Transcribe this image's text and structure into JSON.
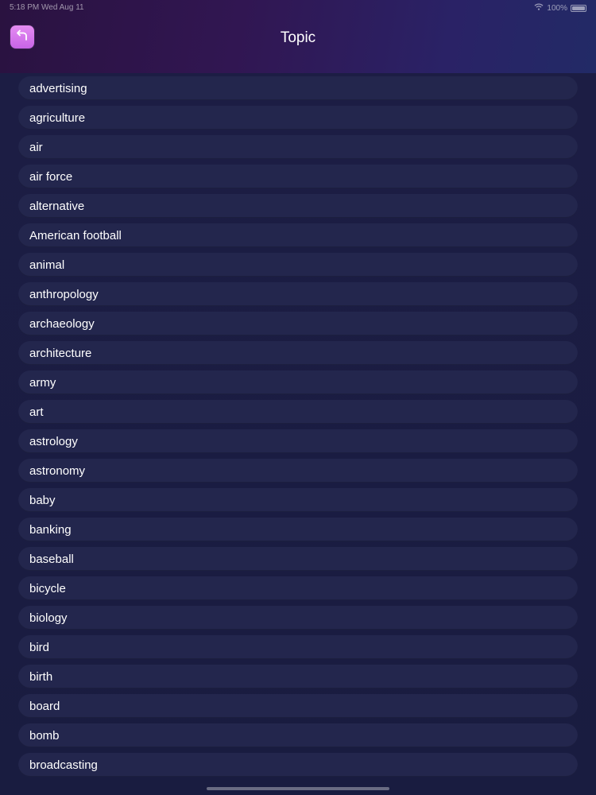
{
  "status_bar": {
    "time_date": "5:18 PM   Wed Aug 11",
    "battery": "100%"
  },
  "header": {
    "title": "Topic",
    "back_icon": "back-arrow-icon"
  },
  "topics": [
    "advertising",
    "agriculture",
    "air",
    "air force",
    "alternative",
    "American football",
    "animal",
    "anthropology",
    "archaeology",
    "architecture",
    "army",
    "art",
    "astrology",
    "astronomy",
    "baby",
    "banking",
    "baseball",
    "bicycle",
    "biology",
    "bird",
    "birth",
    "board",
    "bomb",
    "broadcasting"
  ],
  "colors": {
    "accent": "#d97aee",
    "row_background": "#23264d",
    "page_background": "#1a1b40"
  }
}
